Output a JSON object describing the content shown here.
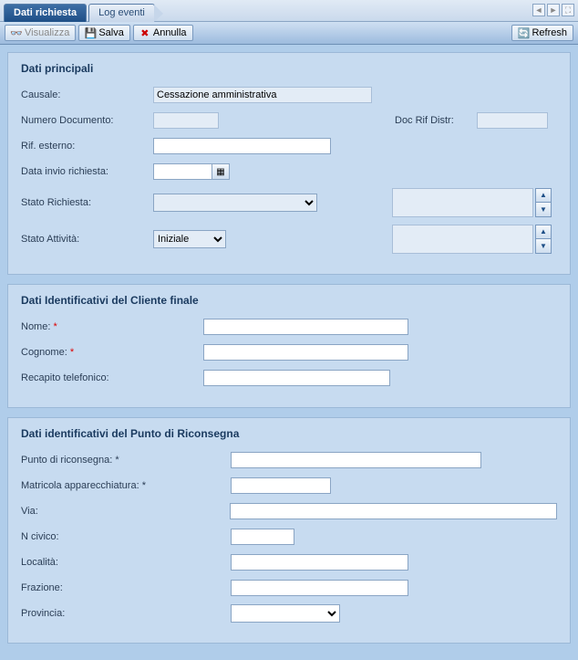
{
  "tabs": {
    "active": "Dati richiesta",
    "inactive": "Log eventi"
  },
  "toolbar": {
    "visualizza": "Visualizza",
    "salva": "Salva",
    "annulla": "Annulla",
    "refresh": "Refresh"
  },
  "section1": {
    "title": "Dati principali",
    "causale_label": "Causale:",
    "causale_value": "Cessazione amministrativa",
    "numdoc_label": "Numero Documento:",
    "docrif_label": "Doc Rif Distr:",
    "rifest_label": "Rif. esterno:",
    "datainv_label": "Data invio richiesta:",
    "statorich_label": "Stato Richiesta:",
    "statoatt_label": "Stato Attività:",
    "statoatt_value": "Iniziale"
  },
  "section2": {
    "title": "Dati Identificativi del Cliente finale",
    "nome": "Nome:",
    "cognome": "Cognome:",
    "recapito": "Recapito telefonico:"
  },
  "section3": {
    "title": "Dati identificativi del Punto di Riconsegna",
    "punto": "Punto di riconsegna:",
    "matricola": "Matricola apparecchiatura:",
    "via": "Via:",
    "ncivico": "N civico:",
    "localita": "Località:",
    "frazione": "Frazione:",
    "provincia": "Provincia:"
  }
}
